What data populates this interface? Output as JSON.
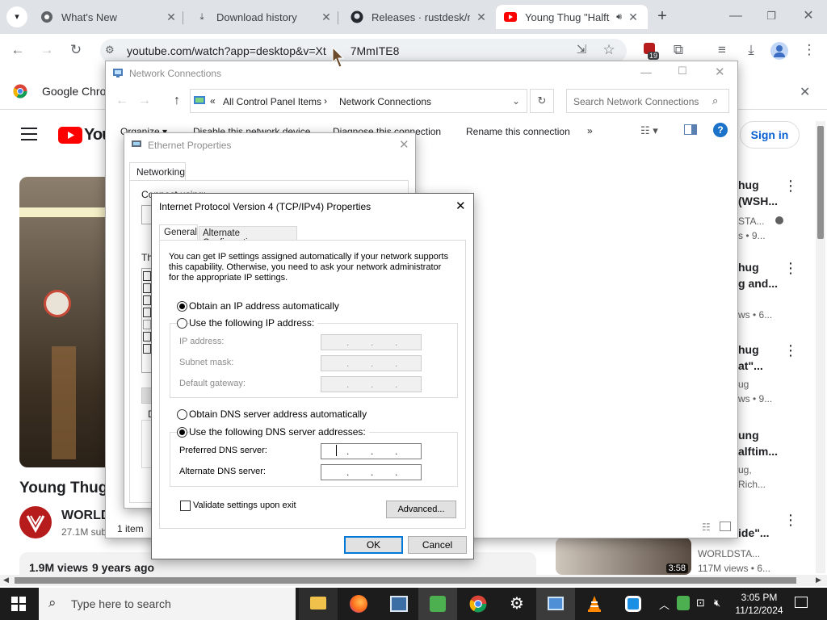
{
  "chrome": {
    "tabs": [
      {
        "title": "What's New",
        "icon": "chrome-icon"
      },
      {
        "title": "Download history",
        "icon": "download-icon"
      },
      {
        "title": "Releases · rustdesk/rus",
        "icon": "github-icon"
      },
      {
        "title": "Young Thug \"Halft",
        "icon": "youtube-icon"
      }
    ],
    "url": "youtube.com/watch?app=desktop&v=Xt",
    "url_tail": "7MmITE8",
    "extension_badge": "19",
    "infobar_text": "Google Chrom"
  },
  "youtube": {
    "logo": "You",
    "signin": "Sign in",
    "video_title": "Young Thug",
    "channel": "WORLD",
    "subs": "27.1M sub",
    "views": "1.9M views",
    "age": "9 years ago",
    "side_items": [
      {
        "title1": "hug",
        "title2": "(WSH...",
        "meta1": "STA...",
        "meta2": "s • 9..."
      },
      {
        "title1": "hug",
        "title2": "g and...",
        "meta1": "",
        "meta2": "ws • 6..."
      },
      {
        "title1": "hug",
        "title2": "at\"...",
        "meta1": "ug",
        "meta2": "ws • 9..."
      },
      {
        "title1": "ung",
        "title2": "alftim...",
        "meta1": "ug,",
        "meta2": "Rich..."
      },
      {
        "title1": "",
        "title2": "ide\"...",
        "meta1": "WORLDSTA...",
        "meta2": "117M views • 6..."
      }
    ],
    "thumb_time": "3:58"
  },
  "network_connections": {
    "title": "Network Connections",
    "crumb1": "All Control Panel Items",
    "crumb2": "Network Connections",
    "search_placeholder": "Search Network Connections",
    "cmd_organize": "Organize ▾",
    "cmd_disable": "Disable this network device",
    "cmd_diagnose": "Diagnose this connection",
    "cmd_rename": "Rename this connection",
    "cmd_more": "»",
    "status": "1 item"
  },
  "ethernet_properties": {
    "title": "Ethernet Properties",
    "tab": "Networking",
    "connect_using": "Connect using:",
    "this_conn": "Th",
    "desc": "D"
  },
  "ipv4": {
    "title": "Internet Protocol Version 4 (TCP/IPv4) Properties",
    "tabs": [
      "General",
      "Alternate Configuration"
    ],
    "intro": [
      "You can get IP settings assigned automatically if your network supports",
      "this capability. Otherwise, you need to ask your network administrator",
      "for the appropriate IP settings."
    ],
    "obtain_ip": "Obtain an IP address automatically",
    "use_ip": "Use the following IP address:",
    "ip_label": "IP address:",
    "subnet_label": "Subnet mask:",
    "gateway_label": "Default gateway:",
    "obtain_dns": "Obtain DNS server address automatically",
    "use_dns": "Use the following DNS server addresses:",
    "pref_dns": "Preferred DNS server:",
    "alt_dns": "Alternate DNS server:",
    "validate": "Validate settings upon exit",
    "advanced": "Advanced...",
    "ok": "OK",
    "cancel": "Cancel"
  },
  "taskbar": {
    "search": "Type here to search",
    "time": "3:05 PM",
    "date": "11/12/2024"
  }
}
